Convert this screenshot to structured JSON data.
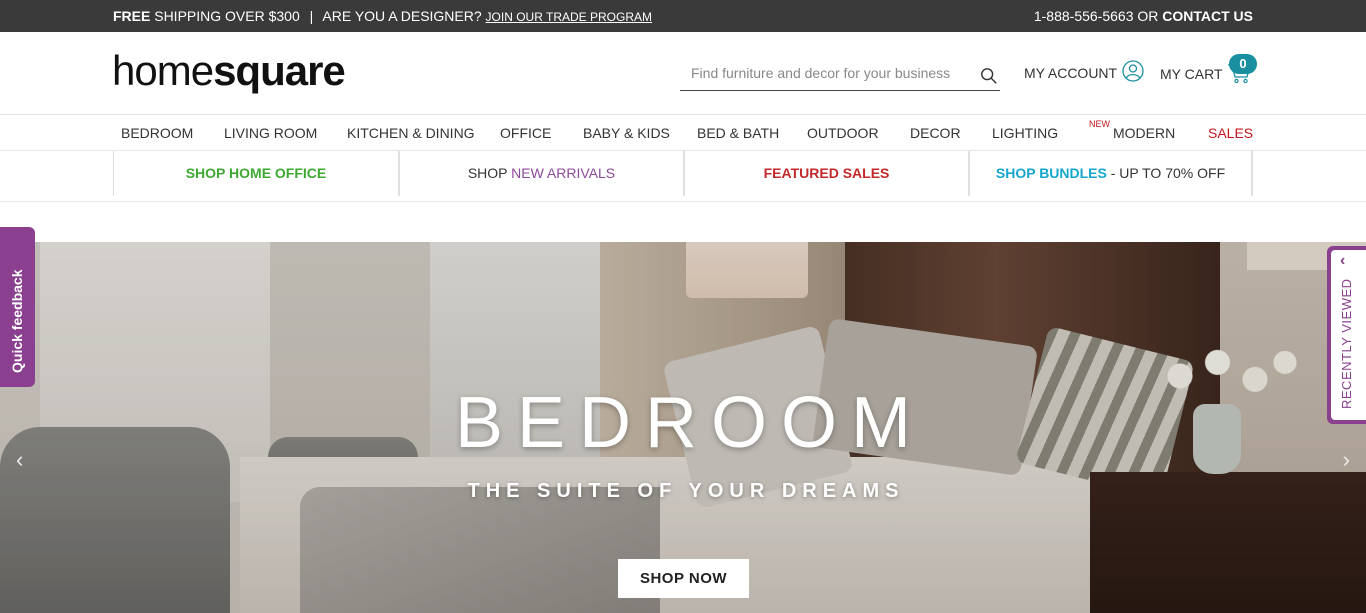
{
  "topbar": {
    "free": "FREE",
    "shipping": "SHIPPING OVER $300",
    "sep": "|",
    "designer": "ARE YOU A DESIGNER?",
    "trade_link": "JOIN OUR TRADE PROGRAM",
    "phone": "1-888-556-5663 OR",
    "contact": "CONTACT US"
  },
  "header": {
    "logo_thin": "home",
    "logo_bold": "square",
    "search_placeholder": "Find furniture and decor for your business",
    "account_label": "MY ACCOUNT",
    "cart_label": "MY CART",
    "cart_count": "0"
  },
  "nav": {
    "items": [
      "BEDROOM",
      "LIVING ROOM",
      "KITCHEN & DINING",
      "OFFICE",
      "BABY & KIDS",
      "BED & BATH",
      "OUTDOOR",
      "DECOR",
      "LIGHTING",
      "MODERN",
      "SALES"
    ],
    "new_tag": "NEW"
  },
  "promo": {
    "home_office": "SHOP HOME OFFICE",
    "shop": "SHOP",
    "new_arrivals": "NEW ARRIVALS",
    "featured": "FEATURED SALES",
    "bundles": "SHOP BUNDLES",
    "bundles_suffix": "- UP TO 70% OFF"
  },
  "hero": {
    "title": "BEDROOM",
    "subtitle": "THE SUITE OF YOUR DREAMS",
    "button": "SHOP NOW"
  },
  "side": {
    "feedback": "Quick feedback",
    "recent": "RECENTLY VIEWED"
  },
  "colors": {
    "topbar": "#3a3a3a",
    "accent_purple": "#8a3f8f",
    "badge": "#1a8fa0",
    "sale_red": "#c4161c"
  }
}
